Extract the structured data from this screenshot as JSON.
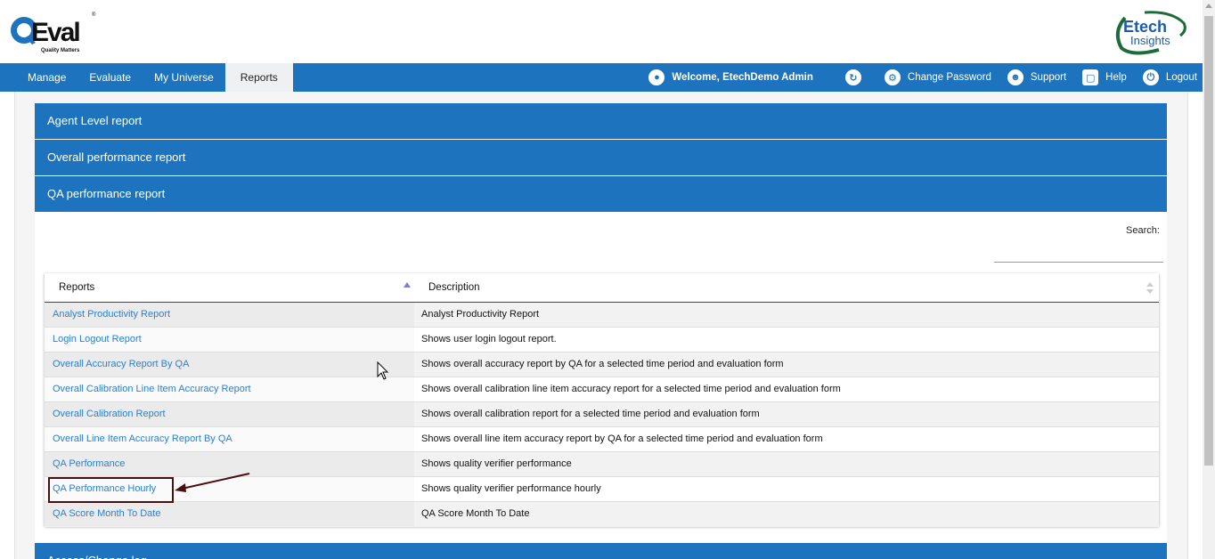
{
  "header": {
    "logo_left": {
      "name": "QEval",
      "tagline": "Quality Matters"
    },
    "logo_right": {
      "line1": "Etech",
      "line2": "Insights"
    }
  },
  "nav": {
    "left_items": [
      {
        "label": "Manage"
      },
      {
        "label": "Evaluate"
      },
      {
        "label": "My Universe"
      },
      {
        "label": "Reports",
        "active": true
      }
    ],
    "welcome": "Welcome, EtechDemo Admin",
    "change_password": "Change Password",
    "support": "Support",
    "help": "Help",
    "logout": "Logout",
    "icons": [
      "user-icon",
      "refresh-icon",
      "gear-icon",
      "support-icon",
      "help-icon",
      "power-icon"
    ]
  },
  "accordions": [
    {
      "label": "Agent Level report"
    },
    {
      "label": "Overall performance report"
    },
    {
      "label": "QA performance report"
    },
    {
      "label": "Access/Change log"
    }
  ],
  "search": {
    "label": "Search:",
    "value": ""
  },
  "table": {
    "headers": {
      "reports": "Reports",
      "description": "Description"
    },
    "rows": [
      {
        "report": "Analyst Productivity Report",
        "description": "Analyst Productivity Report"
      },
      {
        "report": "Login Logout Report",
        "description": "Shows user login logout report."
      },
      {
        "report": "Overall Accuracy Report By QA",
        "description": "Shows overall accuracy report by QA for a selected time period and evaluation form"
      },
      {
        "report": "Overall Calibration Line Item Accuracy Report",
        "description": "Shows overall calibration line item accuracy report for a selected time period and evaluation form"
      },
      {
        "report": "Overall Calibration Report",
        "description": "Shows overall calibration report for a selected time period and evaluation form"
      },
      {
        "report": "Overall Line Item Accuracy Report By QA",
        "description": "Shows overall line item accuracy report by QA for a selected time period and evaluation form"
      },
      {
        "report": "QA Performance",
        "description": "Shows quality verifier performance"
      },
      {
        "report": "QA Performance Hourly",
        "description": "Shows quality verifier performance hourly"
      },
      {
        "report": "QA Score Month To Date",
        "description": "QA Score Month To Date"
      }
    ]
  },
  "colors": {
    "primary": "#1e73be",
    "link": "#2a7fd4",
    "annotation": "#4a0f12"
  }
}
